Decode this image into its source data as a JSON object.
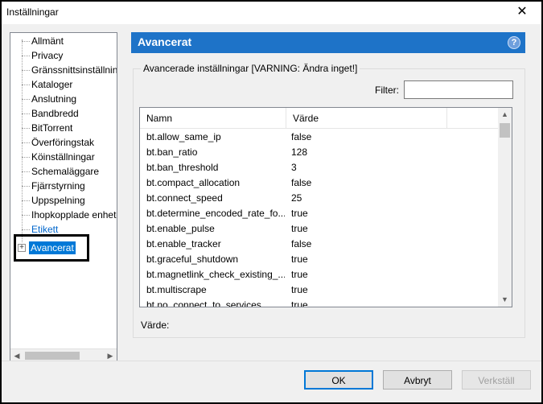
{
  "window": {
    "title": "Inställningar",
    "close_glyph": "✕"
  },
  "tree": {
    "items": [
      {
        "label": "Allmänt"
      },
      {
        "label": "Privacy"
      },
      {
        "label": "Gränssnittsinställningar"
      },
      {
        "label": "Kataloger"
      },
      {
        "label": "Anslutning"
      },
      {
        "label": "Bandbredd"
      },
      {
        "label": "BitTorrent"
      },
      {
        "label": "Överföringstak"
      },
      {
        "label": "Köinställningar"
      },
      {
        "label": "Schemaläggare"
      },
      {
        "label": "Fjärrstyrning"
      },
      {
        "label": "Uppspelning"
      },
      {
        "label": "Ihopkopplade enheter"
      },
      {
        "label": "Etikett"
      }
    ],
    "selected": {
      "label": "Avancerat",
      "expander": "+"
    }
  },
  "panel": {
    "title": "Avancerat",
    "help_glyph": "?",
    "group_title": "Avancerade inställningar [VARNING: Ändra inget!]",
    "filter_label": "Filter:",
    "filter_value": "",
    "value_label": "Värde:"
  },
  "table": {
    "columns": [
      "Namn",
      "Värde"
    ],
    "rows": [
      {
        "name": "bt.allow_same_ip",
        "value": "false"
      },
      {
        "name": "bt.ban_ratio",
        "value": "128"
      },
      {
        "name": "bt.ban_threshold",
        "value": "3"
      },
      {
        "name": "bt.compact_allocation",
        "value": "false"
      },
      {
        "name": "bt.connect_speed",
        "value": "25"
      },
      {
        "name": "bt.determine_encoded_rate_fo...",
        "value": "true"
      },
      {
        "name": "bt.enable_pulse",
        "value": "true"
      },
      {
        "name": "bt.enable_tracker",
        "value": "false"
      },
      {
        "name": "bt.graceful_shutdown",
        "value": "true"
      },
      {
        "name": "bt.magnetlink_check_existing_...",
        "value": "true"
      },
      {
        "name": "bt.multiscrape",
        "value": "true"
      },
      {
        "name": "bt.no_connect_to_services",
        "value": "true"
      }
    ]
  },
  "buttons": {
    "ok": "OK",
    "cancel": "Avbryt",
    "apply": "Verkställ"
  },
  "colors": {
    "header_blue": "#1e73c8",
    "selection_blue": "#0078d7"
  }
}
